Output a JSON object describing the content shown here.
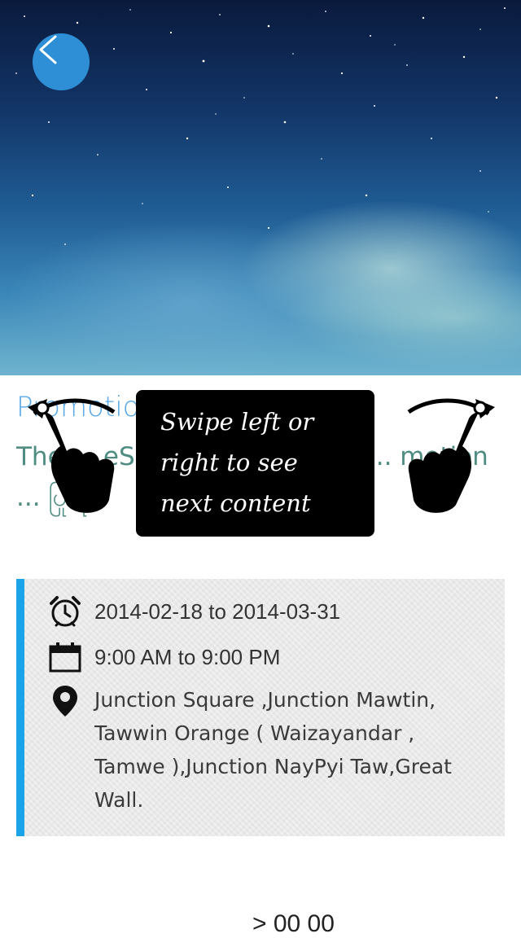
{
  "header": {
    "back_icon": "chevron-left-icon",
    "accent_color": "#2e8fd6"
  },
  "promotion": {
    "title": "Promotion",
    "description": "The ... eS ... uct ... ဖြစ် ... Su ... motion ... ပြုလုပ်"
  },
  "overlay": {
    "line1": "Swipe left or",
    "line2": "right to see",
    "line3": "next content",
    "left_gesture_icon": "swipe-left-hand-icon",
    "right_gesture_icon": "swipe-right-hand-icon"
  },
  "details": {
    "date_range": "2014-02-18 to 2014-03-31",
    "time_range": "9:00 AM to 9:00 PM",
    "address": "Junction Square ,Junction Mawtin, Tawwin Orange ( Waizayandar , Tamwe ),Junction NayPyi Taw,Great Wall.",
    "date_icon": "alarm-clock-icon",
    "time_icon": "calendar-icon",
    "address_icon": "map-pin-icon",
    "accent_color": "#1aa3e8"
  },
  "footer_peek": {
    "text": "> 00 00"
  }
}
